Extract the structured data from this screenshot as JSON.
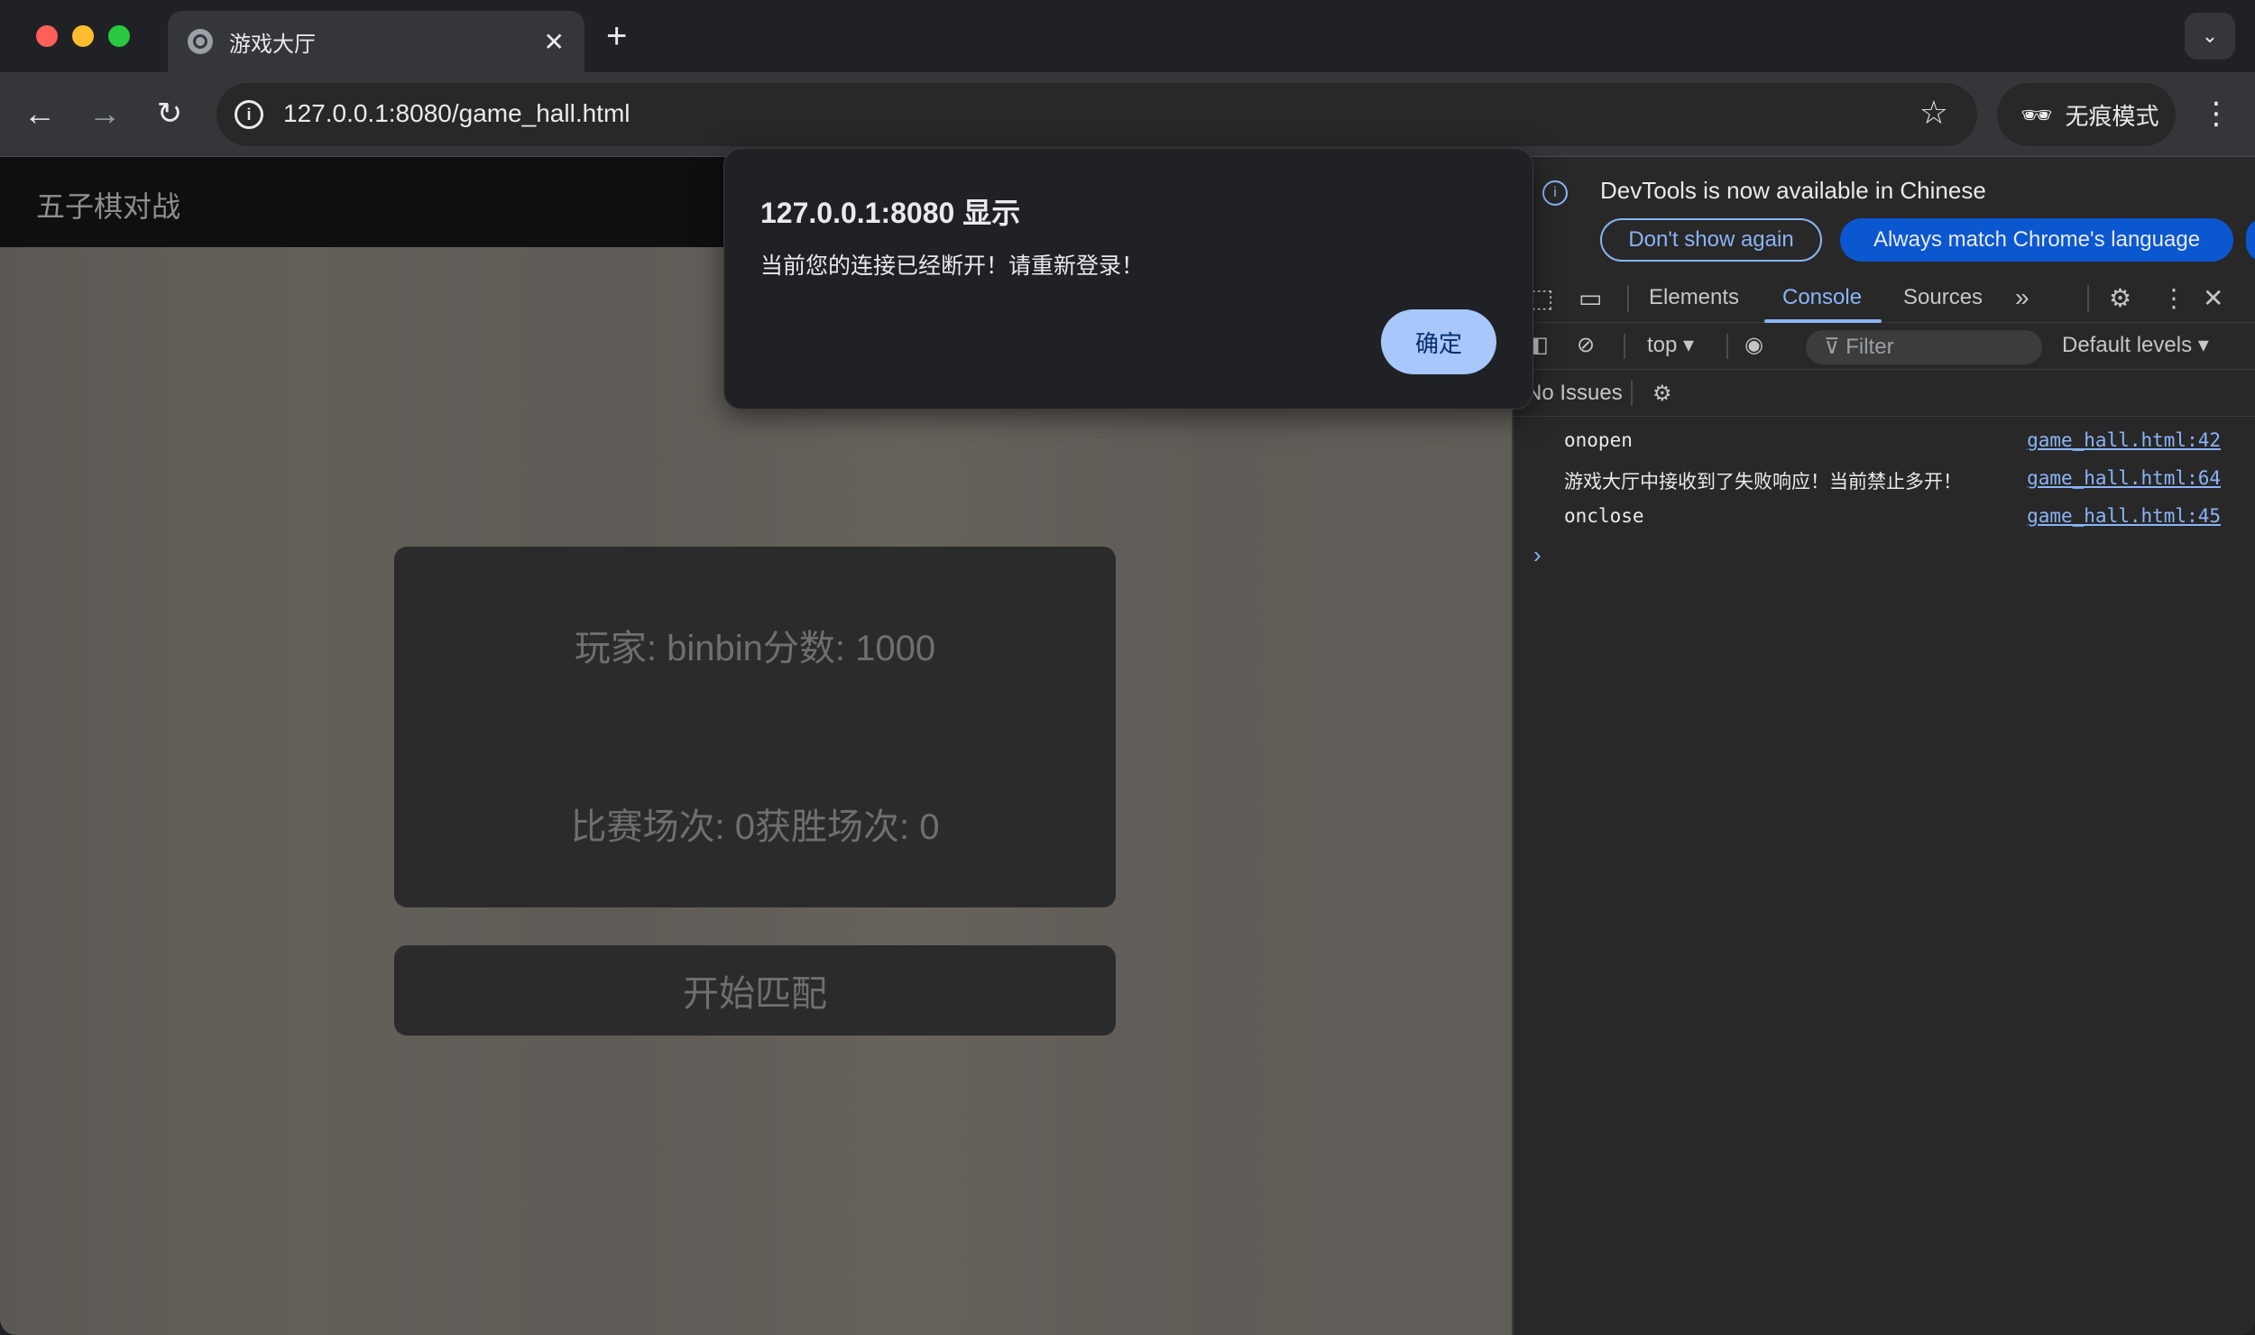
{
  "browser": {
    "tab_title": "游戏大厅",
    "url": "127.0.0.1:8080/game_hall.html",
    "incognito_label": "无痕模式"
  },
  "page": {
    "site_title": "五子棋对战",
    "player_line": "玩家: binbin分数: 1000",
    "stats_line": "比赛场次: 0获胜场次: 0",
    "match_button": "开始匹配"
  },
  "dialog": {
    "title": "127.0.0.1:8080 显示",
    "message": "当前您的连接已经断开！请重新登录！",
    "ok_label": "确定"
  },
  "devtools": {
    "banner_message": "DevTools is now available in Chinese",
    "dont_show_label": "Don't show again",
    "match_language_label": "Always match Chrome's language",
    "tabs": [
      "Elements",
      "Console",
      "Sources"
    ],
    "active_tab": "Console",
    "context": "top",
    "filter_placeholder": "Filter",
    "levels": "Default levels",
    "issues": "No Issues",
    "logs": [
      {
        "text": "onopen",
        "source": "game_hall.html:42"
      },
      {
        "text": "游戏大厅中接收到了失败响应！当前禁止多开！",
        "source": "game_hall.html:64"
      },
      {
        "text": "onclose",
        "source": "game_hall.html:45"
      }
    ]
  },
  "colors": {
    "accent": "#8ab4f8",
    "primary_button": "#a8c7fa",
    "devtools_blue_button": "#0b57d0"
  }
}
